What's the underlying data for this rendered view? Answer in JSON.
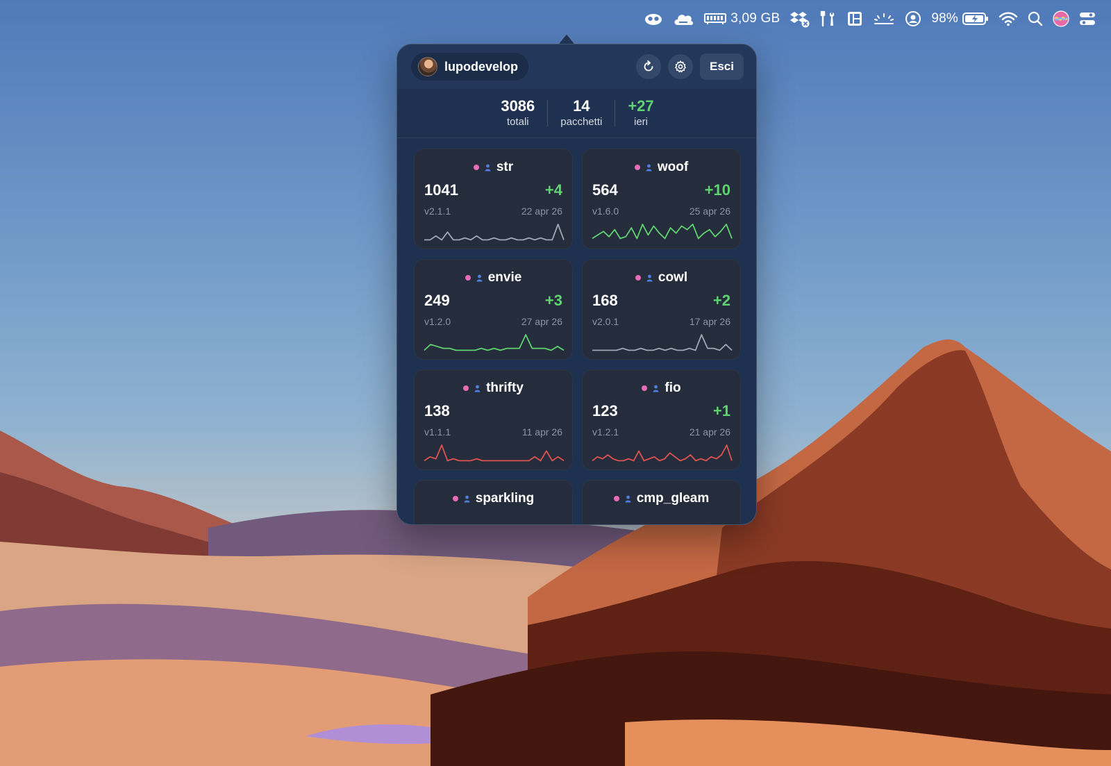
{
  "menubar": {
    "memory_text": "3,09 GB",
    "battery_text": "98%",
    "icons": [
      "copilot-icon",
      "cloud-icon",
      "memory-icon",
      "dropbox-icon",
      "tools-icon",
      "layout-icon",
      "brightness-icon",
      "user-circle-icon",
      "battery-icon",
      "wifi-icon",
      "search-icon",
      "siri-icon",
      "control-center-icon"
    ]
  },
  "header": {
    "username": "lupodevelop",
    "refresh_icon": "refresh-icon",
    "settings_icon": "gear-icon",
    "quit_label": "Esci"
  },
  "summary": {
    "total_value": "3086",
    "total_label": "totali",
    "packages_value": "14",
    "packages_label": "pacchetti",
    "yesterday_value": "+27",
    "yesterday_label": "ieri"
  },
  "colors": {
    "accent_green": "#5fd36f",
    "accent_red": "#e0524f",
    "gray_line": "#a0a7b2",
    "pink_dot": "#e66cb7",
    "person_blue": "#4f7fe0"
  },
  "packages": [
    {
      "name": "str",
      "count": "1041",
      "delta": "+4",
      "version": "v2.1.1",
      "date": "22 apr 26",
      "trend": "gray",
      "spark": [
        2,
        2,
        4,
        2,
        6,
        2,
        2,
        3,
        2,
        4,
        2,
        2,
        3,
        2,
        2,
        3,
        2,
        2,
        3,
        2,
        3,
        2,
        2,
        10,
        2
      ]
    },
    {
      "name": "woof",
      "count": "564",
      "delta": "+10",
      "version": "v1.6.0",
      "date": "25 apr 26",
      "trend": "green",
      "spark": [
        3,
        5,
        7,
        4,
        8,
        3,
        4,
        9,
        3,
        11,
        5,
        10,
        6,
        3,
        9,
        6,
        10,
        8,
        11,
        3,
        6,
        8,
        4,
        7,
        11,
        3
      ]
    },
    {
      "name": "envie",
      "count": "249",
      "delta": "+3",
      "version": "v1.2.0",
      "date": "27 apr 26",
      "trend": "green",
      "spark": [
        2,
        5,
        4,
        3,
        3,
        2,
        2,
        2,
        2,
        3,
        2,
        3,
        2,
        3,
        3,
        3,
        10,
        3,
        3,
        3,
        2,
        4,
        2
      ]
    },
    {
      "name": "cowl",
      "count": "168",
      "delta": "+2",
      "version": "v2.0.1",
      "date": "17 apr 26",
      "trend": "gray",
      "spark": [
        2,
        2,
        2,
        2,
        2,
        3,
        2,
        2,
        3,
        2,
        2,
        3,
        2,
        3,
        2,
        2,
        3,
        2,
        10,
        3,
        3,
        2,
        5,
        2
      ]
    },
    {
      "name": "thrifty",
      "count": "138",
      "delta": "",
      "version": "v1.1.1",
      "date": "11 apr 26",
      "trend": "red",
      "spark": [
        2,
        4,
        3,
        10,
        2,
        3,
        2,
        2,
        2,
        3,
        2,
        2,
        2,
        2,
        2,
        2,
        2,
        2,
        2,
        4,
        2,
        7,
        2,
        4,
        2
      ]
    },
    {
      "name": "fio",
      "count": "123",
      "delta": "+1",
      "version": "v1.2.1",
      "date": "21 apr 26",
      "trend": "red",
      "spark": [
        2,
        4,
        3,
        5,
        3,
        2,
        2,
        3,
        2,
        7,
        2,
        3,
        4,
        2,
        3,
        6,
        4,
        2,
        3,
        5,
        2,
        3,
        2,
        4,
        3,
        5,
        10,
        2
      ]
    },
    {
      "name": "sparkling",
      "count": "",
      "delta": "",
      "version": "",
      "date": "",
      "trend": "gray",
      "spark": []
    },
    {
      "name": "cmp_gleam",
      "count": "",
      "delta": "",
      "version": "",
      "date": "",
      "trend": "gray",
      "spark": []
    }
  ]
}
